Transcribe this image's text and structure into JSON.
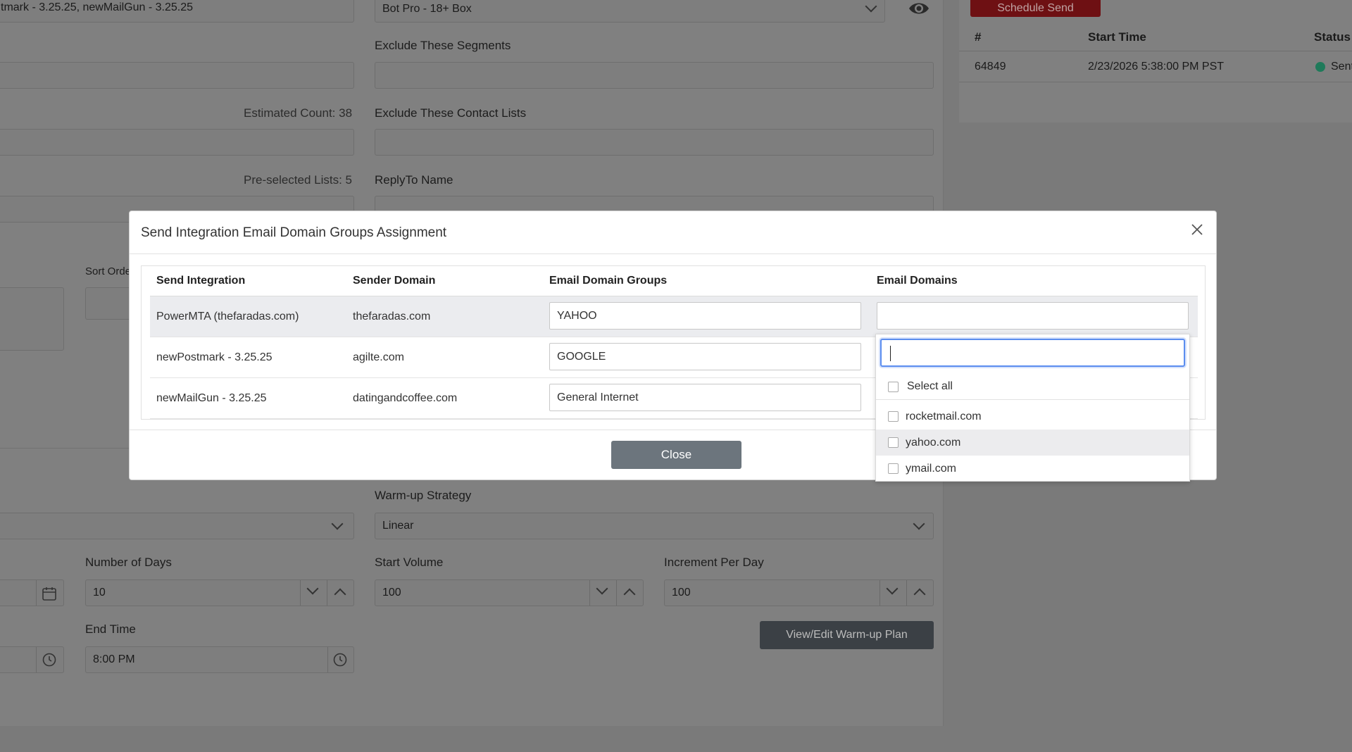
{
  "background": {
    "top_field_value": "tmark - 3.25.25, newMailGun - 3.25.25",
    "segment_select_value": "Bot Pro - 18+ Box",
    "exclude_segments_label": "Exclude These Segments",
    "estimated_count": "Estimated Count: 38",
    "exclude_contact_lists_label": "Exclude These Contact Lists",
    "preselected_lists": "Pre-selected Lists: 5",
    "reply_to_name_label": "ReplyTo Name",
    "sort_order_label": "Sort Orde",
    "warmup_strategy_label": "Warm-up Strategy",
    "warmup_strategy_value": "Linear",
    "number_of_days_label": "Number of Days",
    "number_of_days_value": "10",
    "start_volume_label": "Start Volume",
    "start_volume_value": "100",
    "increment_per_day_label": "Increment Per Day",
    "increment_per_day_value": "100",
    "end_time_label": "End Time",
    "end_time_value": "8:00 PM",
    "view_edit_button": "View/Edit Warm-up Plan",
    "schedule_send_button": "Schedule Send",
    "sends_table": {
      "headers": [
        "#",
        "Start Time",
        "Status"
      ],
      "row": {
        "id": "64849",
        "start_time": "2/23/2026 5:38:00 PM PST",
        "status": "Sent"
      },
      "status_color": "#2aa877"
    }
  },
  "modal": {
    "title": "Send Integration Email Domain Groups Assignment",
    "columns": [
      "Send Integration",
      "Sender Domain",
      "Email Domain Groups",
      "Email Domains"
    ],
    "rows": [
      {
        "integration": "PowerMTA (thefaradas.com)",
        "sender_domain": "thefaradas.com",
        "group": "YAHOO"
      },
      {
        "integration": "newPostmark - 3.25.25",
        "sender_domain": "agilte.com",
        "group": "GOOGLE"
      },
      {
        "integration": "newMailGun - 3.25.25",
        "sender_domain": "datingandcoffee.com",
        "group": "General Internet"
      }
    ],
    "close_button": "Close"
  },
  "dropdown": {
    "search_value": "",
    "select_all": "Select all",
    "options": [
      "rocketmail.com",
      "yahoo.com",
      "ymail.com"
    ],
    "focus_color": "#5b8def"
  }
}
